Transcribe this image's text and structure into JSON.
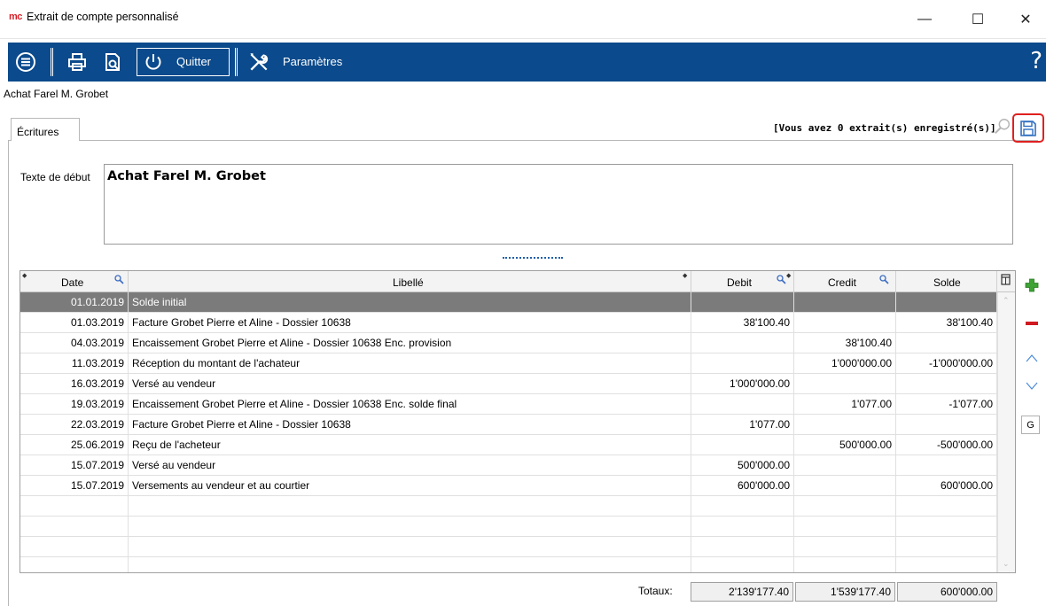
{
  "window": {
    "logo": "mc",
    "title": "Extrait de compte personnalisé",
    "minimize": "—",
    "maximize": "☐",
    "close": "✕"
  },
  "toolbar": {
    "quit_label": "Quitter",
    "settings_label": "Paramètres",
    "help_label": "?"
  },
  "doc_title": "Achat Farel M. Grobet",
  "tab_label": "Écritures",
  "extract_info": "[Vous avez 0 extrait(s) enregistré(s)]",
  "start_text": {
    "label": "Texte de début",
    "value": "Achat Farel M. Grobet"
  },
  "grid": {
    "headers": {
      "date": "Date",
      "libelle": "Libellé",
      "debit": "Debit",
      "credit": "Credit",
      "solde": "Solde"
    },
    "rows": [
      {
        "date": "01.01.2019",
        "libelle": "Solde initial",
        "debit": "",
        "credit": "",
        "solde": "",
        "selected": true
      },
      {
        "date": "01.03.2019",
        "libelle": "Facture Grobet Pierre et Aline - Dossier 10638",
        "debit": "38'100.40",
        "credit": "",
        "solde": "38'100.40"
      },
      {
        "date": "04.03.2019",
        "libelle": "Encaissement Grobet Pierre et Aline - Dossier 10638 Enc. provision",
        "debit": "",
        "credit": "38'100.40",
        "solde": ""
      },
      {
        "date": "11.03.2019",
        "libelle": "Réception du montant de l'achateur",
        "debit": "",
        "credit": "1'000'000.00",
        "solde": "-1'000'000.00"
      },
      {
        "date": "16.03.2019",
        "libelle": "Versé au vendeur",
        "debit": "1'000'000.00",
        "credit": "",
        "solde": ""
      },
      {
        "date": "19.03.2019",
        "libelle": "Encaissement Grobet Pierre et Aline - Dossier 10638 Enc. solde final",
        "debit": "",
        "credit": "1'077.00",
        "solde": "-1'077.00"
      },
      {
        "date": "22.03.2019",
        "libelle": "Facture Grobet Pierre et Aline - Dossier 10638",
        "debit": "1'077.00",
        "credit": "",
        "solde": ""
      },
      {
        "date": "25.06.2019",
        "libelle": "Reçu de l'acheteur",
        "debit": "",
        "credit": "500'000.00",
        "solde": "-500'000.00"
      },
      {
        "date": "15.07.2019",
        "libelle": "Versé au vendeur",
        "debit": "500'000.00",
        "credit": "",
        "solde": ""
      },
      {
        "date": "15.07.2019",
        "libelle": "Versements au vendeur et au courtier",
        "debit": "600'000.00",
        "credit": "",
        "solde": "600'000.00"
      },
      {
        "date": "",
        "libelle": "",
        "debit": "",
        "credit": "",
        "solde": ""
      },
      {
        "date": "",
        "libelle": "",
        "debit": "",
        "credit": "",
        "solde": ""
      },
      {
        "date": "",
        "libelle": "",
        "debit": "",
        "credit": "",
        "solde": ""
      },
      {
        "date": "",
        "libelle": "",
        "debit": "",
        "credit": "",
        "solde": ""
      }
    ]
  },
  "side_buttons": {
    "g_label": "G"
  },
  "totals": {
    "label": "Totaux:",
    "debit": "2'139'177.40",
    "credit": "1'539'177.40",
    "solde": "600'000.00"
  },
  "colors": {
    "toolbar": "#0b4a8c",
    "selected_row": "#7b7b7b",
    "highlight": "#e02020"
  }
}
